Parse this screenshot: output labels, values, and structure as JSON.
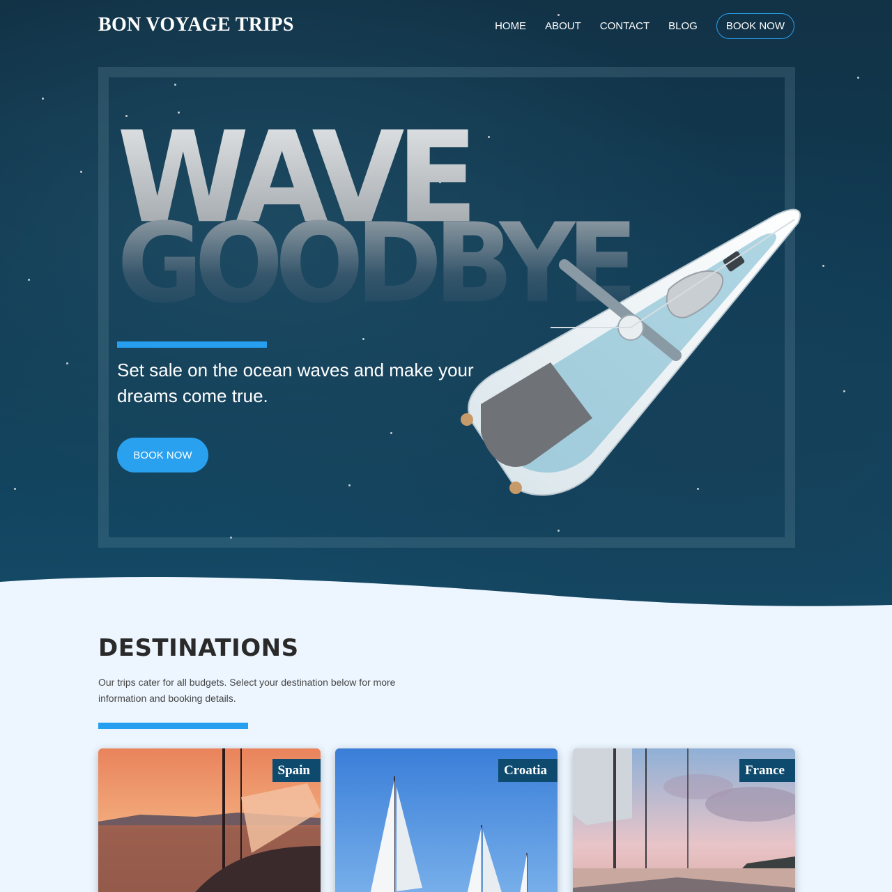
{
  "brand": {
    "name": "BON VOYAGE TRIPS"
  },
  "nav": {
    "items": [
      "HOME",
      "ABOUT",
      "CONTACT",
      "BLOG"
    ],
    "cta": "BOOK NOW"
  },
  "hero": {
    "headline_line1": "WAVE",
    "headline_line2": "GOODBYE",
    "tagline": "Set sale on the ocean waves and make your dreams come true.",
    "button": "BOOK NOW"
  },
  "destinations": {
    "title": "DESTINATIONS",
    "description": "Our trips cater for all budgets. Select your destination below for more information and booking details.",
    "cards": [
      {
        "label": "Spain"
      },
      {
        "label": "Croatia"
      },
      {
        "label": "France"
      }
    ]
  },
  "colors": {
    "accent": "#279ff0",
    "ocean": "#123246",
    "label_bg": "#0d4a6e",
    "page_bg": "#edf6ff"
  }
}
